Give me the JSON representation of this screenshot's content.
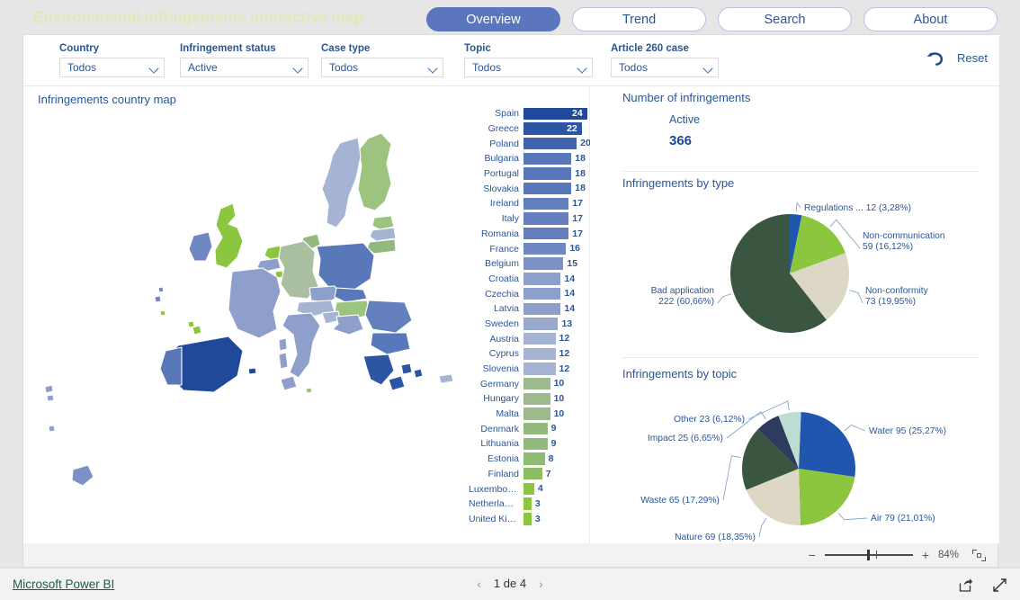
{
  "header": {
    "title": "Environmental infringements interactive map",
    "title_color": "#dfeaba",
    "tabs": [
      {
        "label": "Overview",
        "active": true
      },
      {
        "label": "Trend",
        "active": false
      },
      {
        "label": "Search",
        "active": false
      },
      {
        "label": "About",
        "active": false
      }
    ],
    "active_tab_color": "#5b76bc"
  },
  "filters": {
    "items": [
      {
        "label": "Country",
        "value": "Todos",
        "left": 40,
        "width": 117
      },
      {
        "label": "Infringement status",
        "value": "Active",
        "left": 174,
        "width": 143
      },
      {
        "label": "Case type",
        "value": "Todos",
        "left": 331,
        "width": 136
      },
      {
        "label": "Topic",
        "value": "Todos",
        "left": 490,
        "width": 143
      },
      {
        "label": "Article 260 case",
        "value": "Todos",
        "left": 653,
        "width": 120
      }
    ],
    "reset_label": "Reset",
    "reset_icon": "undo-arrow-icon"
  },
  "map_panel": {
    "title": "Infringements country map"
  },
  "chart_data": [
    {
      "type": "bar",
      "orientation": "horizontal",
      "title": "Infringements country map",
      "xlabel": "",
      "ylabel": "",
      "categories": [
        "Spain",
        "Greece",
        "Poland",
        "Bulgaria",
        "Portugal",
        "Slovakia",
        "Ireland",
        "Italy",
        "Romania",
        "France",
        "Belgium",
        "Croatia",
        "Czechia",
        "Latvia",
        "Sweden",
        "Austria",
        "Cyprus",
        "Slovenia",
        "Germany",
        "Hungary",
        "Malta",
        "Denmark",
        "Lithuania",
        "Estonia",
        "Finland",
        "Luxembourg",
        "Netherlands",
        "United King..."
      ],
      "values": [
        24,
        22,
        20,
        18,
        18,
        18,
        17,
        17,
        17,
        16,
        15,
        14,
        14,
        14,
        13,
        12,
        12,
        12,
        10,
        10,
        10,
        9,
        9,
        8,
        7,
        4,
        3,
        3
      ],
      "xlim": [
        0,
        24
      ],
      "colors": [
        "#20499b",
        "#2c55a4",
        "#3f63ad",
        "#5878b9",
        "#5878b9",
        "#5878b9",
        "#647fbd",
        "#647fbd",
        "#647fbd",
        "#6f88c2",
        "#7c92c7",
        "#8e9fcc",
        "#8e9fcc",
        "#8e9fcc",
        "#9aaacf",
        "#a5b4d3",
        "#a5b4d3",
        "#a5b4d3",
        "#9cba8e",
        "#9cba8e",
        "#9cba8e",
        "#93b97f",
        "#93b97f",
        "#8ebc72",
        "#8cbf63",
        "#8cc63f",
        "#8cc63f",
        "#8cc63f"
      ],
      "grid": false,
      "legend": "none"
    },
    {
      "type": "pie",
      "title": "Infringements by type",
      "legend": "callout-labels",
      "labels": [
        "Regulations ...",
        "Non-communication",
        "Non-conformity",
        "Bad application"
      ],
      "values": [
        12,
        59,
        73,
        222
      ],
      "percent_labels": [
        "3,28%",
        "16,12%",
        "19,95%",
        "60,66%"
      ],
      "annotations": [
        "Regulations ... 12 (3,28%)",
        "Non-communication 59 (16,12%)",
        "Non-conformity 73 (19,95%)",
        "Bad application 222 (60,66%)"
      ],
      "colors": [
        "#2156ae",
        "#8cc63f",
        "#ddd8c6",
        "#3a5540"
      ]
    },
    {
      "type": "pie",
      "title": "Infringements by topic",
      "legend": "callout-labels",
      "labels": [
        "Water",
        "Air",
        "Nature",
        "Waste",
        "Impact",
        "Other"
      ],
      "values": [
        95,
        79,
        69,
        65,
        25,
        23
      ],
      "percent_labels": [
        "25,27%",
        "21,01%",
        "18,35%",
        "17,29%",
        "6,65%",
        "6,12%"
      ],
      "annotations": [
        "Water 95 (25,27%)",
        "Air 79 (21,01%)",
        "Nature 69 (18,35%)",
        "Waste 65 (17,29%)",
        "Impact 25 (6,65%)",
        "Other 23 (6,12%)"
      ],
      "colors": [
        "#2156ae",
        "#8cc63f",
        "#ddd8c6",
        "#3a5540",
        "#2e3b5c",
        "#bcddd2"
      ]
    }
  ],
  "kpi": {
    "title": "Number of infringements",
    "sub_label": "Active",
    "value": "366"
  },
  "pies": {
    "type_title": "Infringements by type",
    "topic_title": "Infringements by topic"
  },
  "zoombar": {
    "minus": "−",
    "plus": "+",
    "percent": "84%",
    "fit_icon": "fit-to-page-icon"
  },
  "footer": {
    "powerbi_link": "Microsoft Power BI",
    "prev_icon": "chevron-left-icon",
    "next_icon": "chevron-right-icon",
    "page_text": "1 de 4",
    "share_icon": "share-icon",
    "fullscreen_icon": "fullscreen-icon"
  }
}
